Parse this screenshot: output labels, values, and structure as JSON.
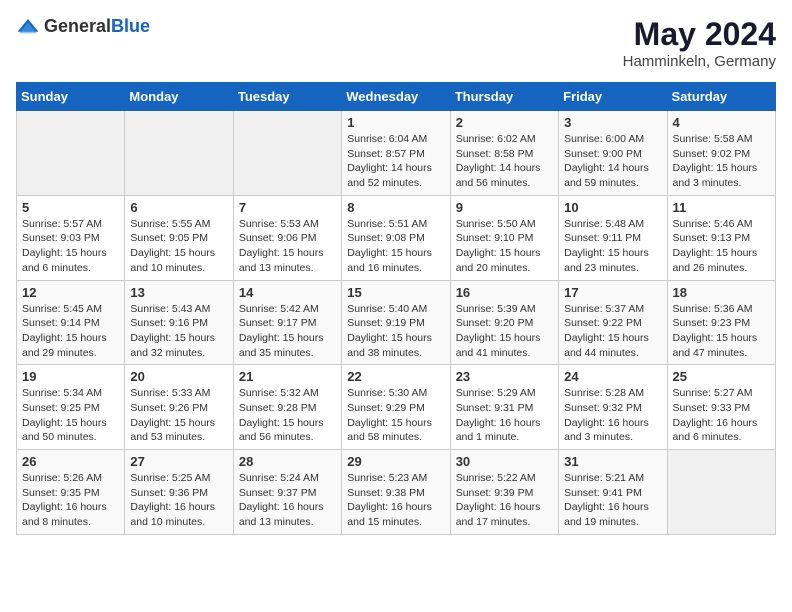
{
  "header": {
    "logo_general": "General",
    "logo_blue": "Blue",
    "month_year": "May 2024",
    "location": "Hamminkeln, Germany"
  },
  "days_of_week": [
    "Sunday",
    "Monday",
    "Tuesday",
    "Wednesday",
    "Thursday",
    "Friday",
    "Saturday"
  ],
  "weeks": [
    [
      {
        "day": "",
        "info": ""
      },
      {
        "day": "",
        "info": ""
      },
      {
        "day": "",
        "info": ""
      },
      {
        "day": "1",
        "info": "Sunrise: 6:04 AM\nSunset: 8:57 PM\nDaylight: 14 hours\nand 52 minutes."
      },
      {
        "day": "2",
        "info": "Sunrise: 6:02 AM\nSunset: 8:58 PM\nDaylight: 14 hours\nand 56 minutes."
      },
      {
        "day": "3",
        "info": "Sunrise: 6:00 AM\nSunset: 9:00 PM\nDaylight: 14 hours\nand 59 minutes."
      },
      {
        "day": "4",
        "info": "Sunrise: 5:58 AM\nSunset: 9:02 PM\nDaylight: 15 hours\nand 3 minutes."
      }
    ],
    [
      {
        "day": "5",
        "info": "Sunrise: 5:57 AM\nSunset: 9:03 PM\nDaylight: 15 hours\nand 6 minutes."
      },
      {
        "day": "6",
        "info": "Sunrise: 5:55 AM\nSunset: 9:05 PM\nDaylight: 15 hours\nand 10 minutes."
      },
      {
        "day": "7",
        "info": "Sunrise: 5:53 AM\nSunset: 9:06 PM\nDaylight: 15 hours\nand 13 minutes."
      },
      {
        "day": "8",
        "info": "Sunrise: 5:51 AM\nSunset: 9:08 PM\nDaylight: 15 hours\nand 16 minutes."
      },
      {
        "day": "9",
        "info": "Sunrise: 5:50 AM\nSunset: 9:10 PM\nDaylight: 15 hours\nand 20 minutes."
      },
      {
        "day": "10",
        "info": "Sunrise: 5:48 AM\nSunset: 9:11 PM\nDaylight: 15 hours\nand 23 minutes."
      },
      {
        "day": "11",
        "info": "Sunrise: 5:46 AM\nSunset: 9:13 PM\nDaylight: 15 hours\nand 26 minutes."
      }
    ],
    [
      {
        "day": "12",
        "info": "Sunrise: 5:45 AM\nSunset: 9:14 PM\nDaylight: 15 hours\nand 29 minutes."
      },
      {
        "day": "13",
        "info": "Sunrise: 5:43 AM\nSunset: 9:16 PM\nDaylight: 15 hours\nand 32 minutes."
      },
      {
        "day": "14",
        "info": "Sunrise: 5:42 AM\nSunset: 9:17 PM\nDaylight: 15 hours\nand 35 minutes."
      },
      {
        "day": "15",
        "info": "Sunrise: 5:40 AM\nSunset: 9:19 PM\nDaylight: 15 hours\nand 38 minutes."
      },
      {
        "day": "16",
        "info": "Sunrise: 5:39 AM\nSunset: 9:20 PM\nDaylight: 15 hours\nand 41 minutes."
      },
      {
        "day": "17",
        "info": "Sunrise: 5:37 AM\nSunset: 9:22 PM\nDaylight: 15 hours\nand 44 minutes."
      },
      {
        "day": "18",
        "info": "Sunrise: 5:36 AM\nSunset: 9:23 PM\nDaylight: 15 hours\nand 47 minutes."
      }
    ],
    [
      {
        "day": "19",
        "info": "Sunrise: 5:34 AM\nSunset: 9:25 PM\nDaylight: 15 hours\nand 50 minutes."
      },
      {
        "day": "20",
        "info": "Sunrise: 5:33 AM\nSunset: 9:26 PM\nDaylight: 15 hours\nand 53 minutes."
      },
      {
        "day": "21",
        "info": "Sunrise: 5:32 AM\nSunset: 9:28 PM\nDaylight: 15 hours\nand 56 minutes."
      },
      {
        "day": "22",
        "info": "Sunrise: 5:30 AM\nSunset: 9:29 PM\nDaylight: 15 hours\nand 58 minutes."
      },
      {
        "day": "23",
        "info": "Sunrise: 5:29 AM\nSunset: 9:31 PM\nDaylight: 16 hours\nand 1 minute."
      },
      {
        "day": "24",
        "info": "Sunrise: 5:28 AM\nSunset: 9:32 PM\nDaylight: 16 hours\nand 3 minutes."
      },
      {
        "day": "25",
        "info": "Sunrise: 5:27 AM\nSunset: 9:33 PM\nDaylight: 16 hours\nand 6 minutes."
      }
    ],
    [
      {
        "day": "26",
        "info": "Sunrise: 5:26 AM\nSunset: 9:35 PM\nDaylight: 16 hours\nand 8 minutes."
      },
      {
        "day": "27",
        "info": "Sunrise: 5:25 AM\nSunset: 9:36 PM\nDaylight: 16 hours\nand 10 minutes."
      },
      {
        "day": "28",
        "info": "Sunrise: 5:24 AM\nSunset: 9:37 PM\nDaylight: 16 hours\nand 13 minutes."
      },
      {
        "day": "29",
        "info": "Sunrise: 5:23 AM\nSunset: 9:38 PM\nDaylight: 16 hours\nand 15 minutes."
      },
      {
        "day": "30",
        "info": "Sunrise: 5:22 AM\nSunset: 9:39 PM\nDaylight: 16 hours\nand 17 minutes."
      },
      {
        "day": "31",
        "info": "Sunrise: 5:21 AM\nSunset: 9:41 PM\nDaylight: 16 hours\nand 19 minutes."
      },
      {
        "day": "",
        "info": ""
      }
    ]
  ]
}
